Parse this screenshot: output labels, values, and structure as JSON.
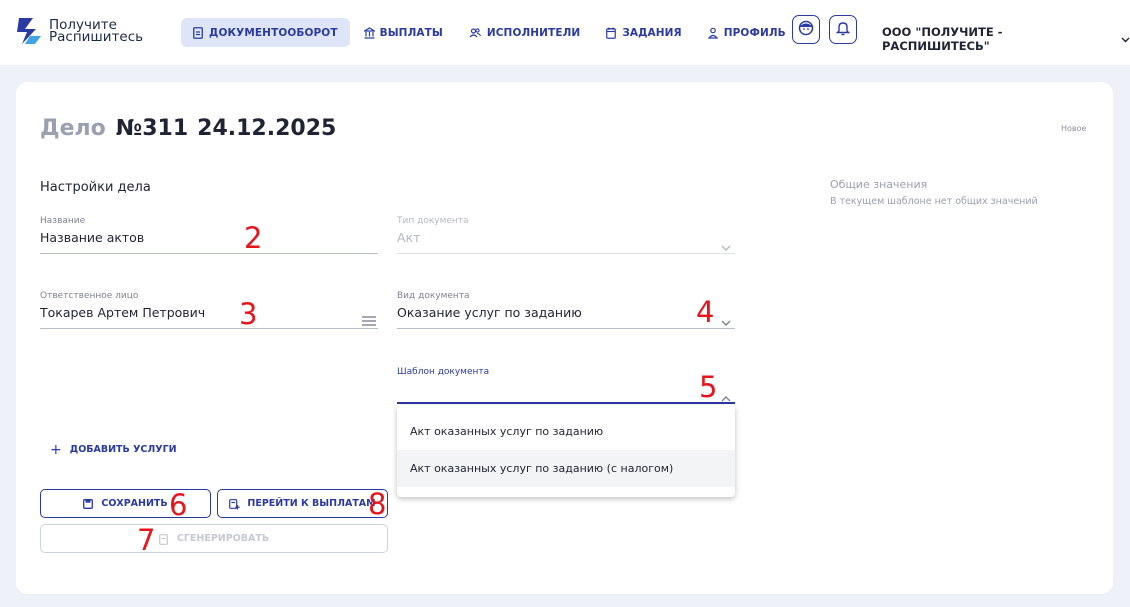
{
  "app": {
    "logo_line1": "Получите",
    "logo_line2": "Распишитесь",
    "company": "ООО \"ПОЛУЧИТЕ - РАСПИШИТЕСЬ\""
  },
  "nav": [
    {
      "label": "ДОКУМЕНТООБОРОТ",
      "icon": "document-icon",
      "active": true
    },
    {
      "label": "ВЫПЛАТЫ",
      "icon": "bank-icon",
      "active": false
    },
    {
      "label": "ИСПОЛНИТЕЛИ",
      "icon": "users-icon",
      "active": false
    },
    {
      "label": "ЗАДАНИЯ",
      "icon": "calendar-icon",
      "active": false
    },
    {
      "label": "ПРОФИЛЬ",
      "icon": "user-icon",
      "active": false
    }
  ],
  "header_buttons": {
    "support_icon": "support-face-icon",
    "notifications_icon": "bell-icon"
  },
  "case": {
    "title_prefix": "Дело",
    "number": "№311",
    "date": "24.12.2025",
    "status": "Новое"
  },
  "settings": {
    "section_title": "Настройки дела",
    "name": {
      "label": "Название",
      "value": "Название актов"
    },
    "doc_type": {
      "label": "Тип документа",
      "value": "Акт"
    },
    "responsible": {
      "label": "Ответственное лицо",
      "value": "Токарев Артем Петрович"
    },
    "doc_kind": {
      "label": "Вид документа",
      "value": "Оказание услуг по заданию"
    },
    "template": {
      "label": "Шаблон документа",
      "value": ""
    }
  },
  "template_options": [
    "Акт оказанных услуг по заданию",
    "Акт оказанных услуг по заданию (с налогом)"
  ],
  "general_values": {
    "title": "Общие значения",
    "subtitle": "В текущем шаблоне нет общих значений"
  },
  "actions": {
    "add_services": "ДОБАВИТЬ УСЛУГИ",
    "save": "СОХРАНИТЬ",
    "go_to_payments": "ПЕРЕЙТИ К ВЫПЛАТАМ",
    "generate": "СГЕНЕРИРОВАТЬ"
  },
  "annotations": {
    "m2": "2",
    "m3": "3",
    "m4": "4",
    "m5": "5",
    "m6": "6",
    "m7": "7",
    "m8": "8"
  },
  "colors": {
    "accent": "#2b3aa3",
    "annotation": "#e8141c",
    "background": "#eef1f8"
  }
}
